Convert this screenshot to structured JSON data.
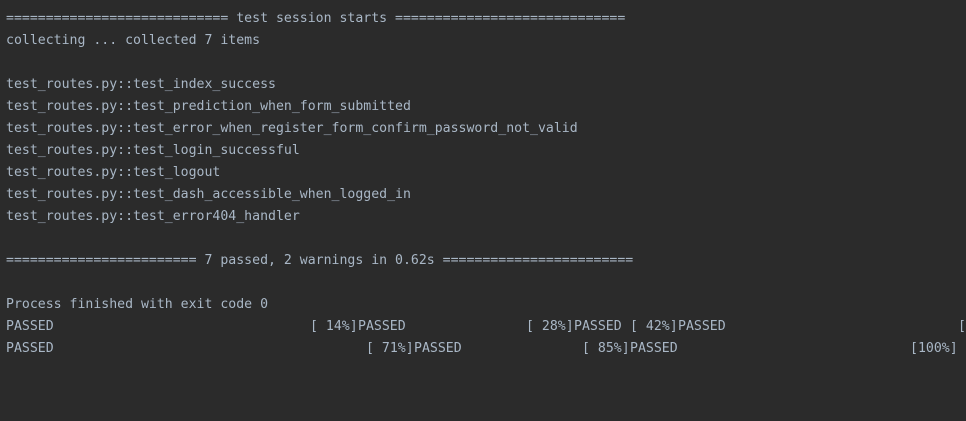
{
  "console": {
    "session_header": "============================ test session starts =============================",
    "collecting": "collecting ... collected 7 items",
    "tests": [
      "test_routes.py::test_index_success",
      "test_routes.py::test_prediction_when_form_submitted",
      "test_routes.py::test_error_when_register_form_confirm_password_not_valid",
      "test_routes.py::test_login_successful",
      "test_routes.py::test_logout",
      "test_routes.py::test_dash_accessible_when_logged_in",
      "test_routes.py::test_error404_handler"
    ],
    "summary": "======================== 7 passed, 2 warnings in 0.62s ========================",
    "process_finished": "Process finished with exit code 0",
    "progress_row1": {
      "passed_a": "PASSED",
      "pct_14": "[ 14%]",
      "passed_b": "PASSED",
      "pct_28": "[ 28%]",
      "passed_c": "PASSED",
      "pct_42": "[ 42%]",
      "passed_d": "PASSED",
      "truncated_bracket": "["
    },
    "progress_row2": {
      "passed_a": "PASSED",
      "pct_71": "[ 71%]",
      "passed_b": "PASSED",
      "pct_85": "[ 85%]",
      "passed_c": "PASSED",
      "pct_100": "[100%]"
    }
  }
}
